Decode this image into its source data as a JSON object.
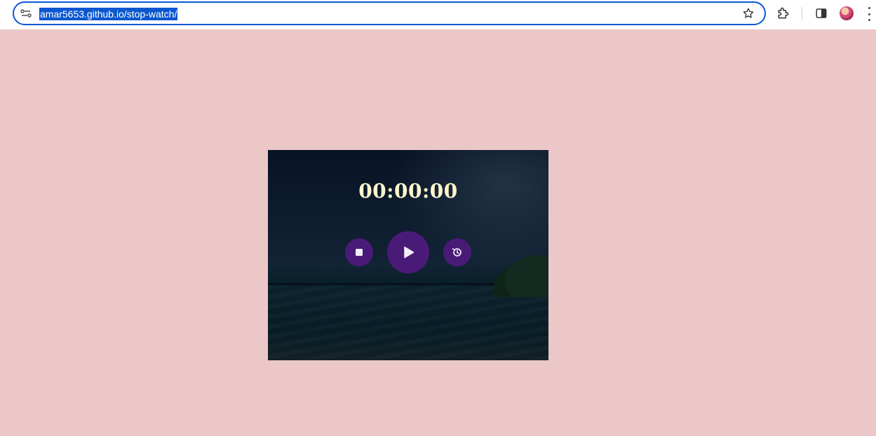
{
  "browser": {
    "url": "amar5653.github.io/stop-watch/"
  },
  "stopwatch": {
    "time": "00:00:00",
    "colors": {
      "background": "#ecc7c7",
      "button": "#4a1a78",
      "time_text": "#fdf6cc"
    },
    "buttons": {
      "stop": "stop-icon",
      "play": "play-icon",
      "reset": "history-icon"
    }
  }
}
